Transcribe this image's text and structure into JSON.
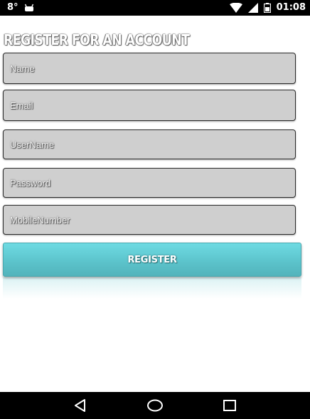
{
  "status_bar": {
    "temperature": "8°",
    "time": "01:08",
    "icons": [
      "weather-icon",
      "android-icon",
      "wifi-icon",
      "signal-icon",
      "battery-icon"
    ]
  },
  "form": {
    "title": "REGISTER FOR AN ACCOUNT",
    "fields": {
      "name": "Name",
      "email": "Email",
      "username": "UserName",
      "password": "Password",
      "mobile": "MobileNumber"
    },
    "submit_label": "REGISTER"
  },
  "nav_bar": {
    "icons": [
      "back-icon",
      "home-icon",
      "recents-icon"
    ]
  },
  "colors": {
    "button_accent": "#5cc4cc",
    "field_bg": "#cfcfcf",
    "bar_bg": "#000000"
  }
}
